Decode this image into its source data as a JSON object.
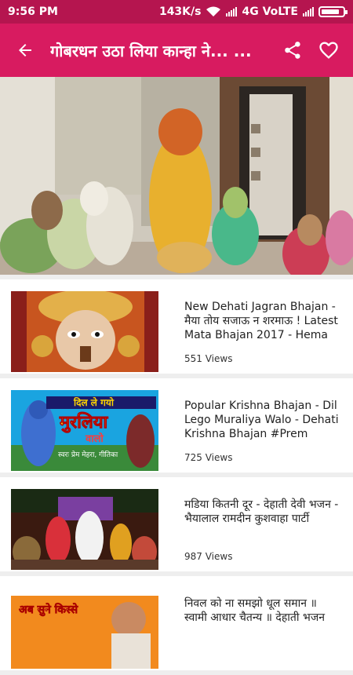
{
  "status": {
    "time": "9:56 PM",
    "speed": "143K/s",
    "network": "4G VoLTE"
  },
  "appbar": {
    "title": "गोबरधन  उठा लिया कान्हा ने... ...",
    "accent": "#d81b60"
  },
  "videos": [
    {
      "title": "New Dehati Jagran Bhajan - मैया तोय सजाऊ न शरमाऊ ! Latest Mata Bhajan 2017 - Hema S...",
      "views": "551 Views"
    },
    {
      "title": "Popular Krishna Bhajan - Dil Lego Muraliya Walo - Dehati Krishna Bhajan #Prem Mehr...",
      "views": "725 Views",
      "thumb_text": [
        "दिल ले गयो",
        "मुरलिया",
        "वालो",
        "स्वरः प्रेम मेहरा, गीतिका"
      ]
    },
    {
      "title": "मडिया कितनी दूर - देहाती देवी भजन - भैयालाल रामदीन कुशवाहा पार्टी",
      "views": "987 Views"
    },
    {
      "title": "निवल को ना समझो धूल समान ॥ स्वामी आधार चैतन्य ॥ देहाती भजन",
      "views": "",
      "thumb_text": [
        "अब सुने किस्से"
      ]
    }
  ]
}
